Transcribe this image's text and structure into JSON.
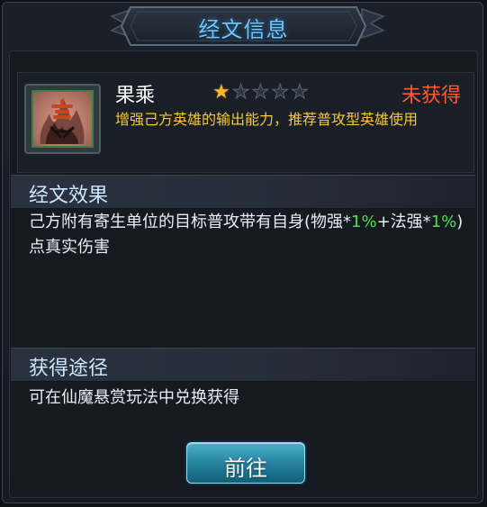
{
  "window": {
    "title": "经文信息"
  },
  "item": {
    "name": "果乘",
    "stars_filled": 1,
    "stars_total": 5,
    "status": "未获得",
    "description": "增强己方英雄的输出能力，推荐普攻型英雄使用",
    "icon": "fire-rune-icon"
  },
  "effect_section": {
    "header": "经文效果",
    "text_parts": [
      {
        "text": "己方附有寄生单位的目标普攻带有自身(物强*",
        "highlight": false
      },
      {
        "text": "1%",
        "highlight": true
      },
      {
        "text": "+法强*",
        "highlight": false
      },
      {
        "text": "1%",
        "highlight": true
      },
      {
        "text": ")点真实伤害",
        "highlight": false
      }
    ]
  },
  "source_section": {
    "header": "获得途径",
    "text": "可在仙魔悬赏玩法中兑换获得"
  },
  "button": {
    "label": "前往"
  },
  "colors": {
    "title": "#6ec6ff",
    "status": "#ff5a33",
    "description": "#f4c93a",
    "highlight": "#4fe04f",
    "star_filled": "#f7b731"
  }
}
